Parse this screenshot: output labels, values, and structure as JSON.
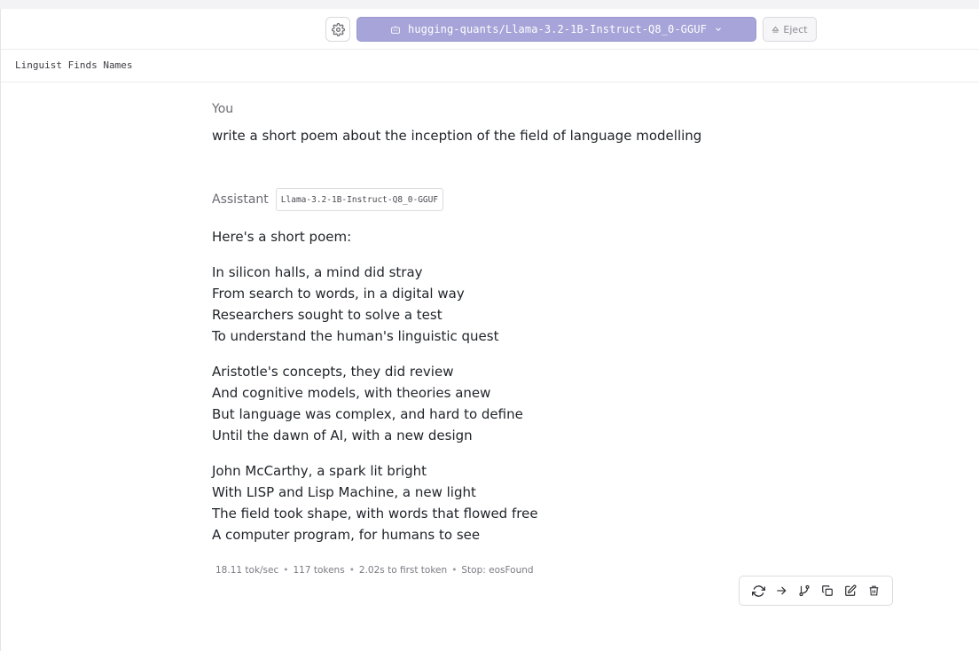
{
  "toolbar": {
    "model_name": "hugging-quants/Llama-3.2-1B-Instruct-Q8_0-GGUF",
    "eject_label": "Eject",
    "accent_color": "#a6a4d8"
  },
  "chat": {
    "title": "Linguist Finds Names"
  },
  "messages": {
    "user": {
      "role": "You",
      "text": "write a short poem about the inception of the field of language modelling"
    },
    "assistant": {
      "role": "Assistant",
      "model_chip": "Llama-3.2-1B-Instruct-Q8_0-GGUF",
      "paragraphs": [
        "Here's a short poem:",
        "In silicon halls, a mind did stray\nFrom search to words, in a digital way\nResearchers sought to solve a test\nTo understand the human's linguistic quest",
        "Aristotle's concepts, they did review\nAnd cognitive models, with theories anew\nBut language was complex, and hard to define\nUntil the dawn of AI, with a new design",
        "John McCarthy, a spark lit bright\nWith LISP and Lisp Machine, a new light\nThe field took shape, with words that flowed free\nA computer program, for humans to see"
      ],
      "stats": {
        "speed": "18.11 tok/sec",
        "tokens": "117 tokens",
        "first_token": "2.02s to first token",
        "stop": "Stop: eosFound"
      }
    }
  },
  "icons": {
    "settings": "gear-icon",
    "model": "robot-icon",
    "dropdown": "chevron-down-icon",
    "eject": "eject-icon",
    "actions": [
      "regenerate-icon",
      "continue-icon",
      "branch-icon",
      "copy-icon",
      "edit-icon",
      "delete-icon"
    ]
  }
}
